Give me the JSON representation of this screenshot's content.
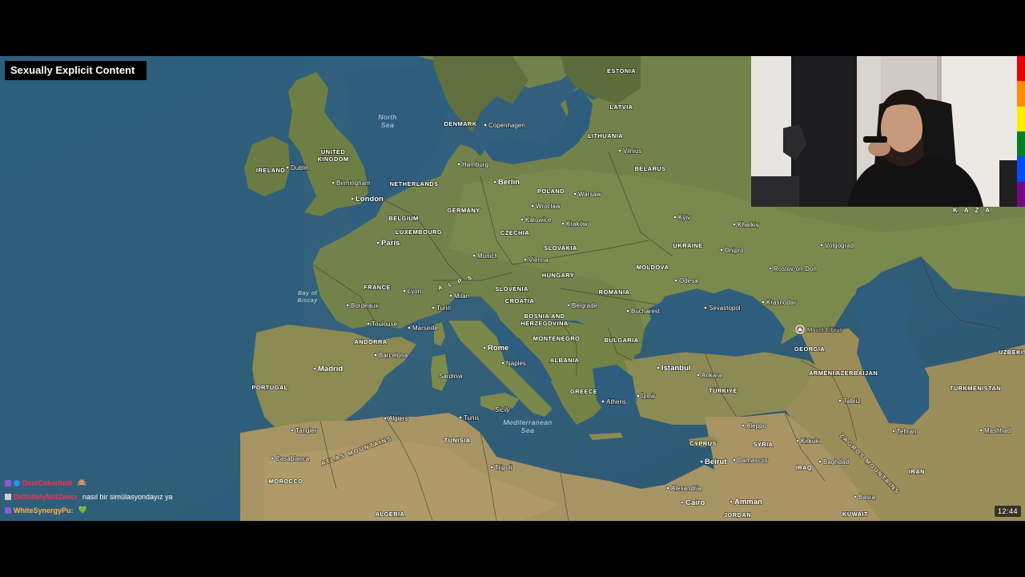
{
  "overlay": {
    "content_label": "Sexually Explicit Content",
    "clock": "12:44",
    "pride_colors": [
      "#e40303",
      "#ff8c00",
      "#ffed00",
      "#008026",
      "#004dff",
      "#750787"
    ]
  },
  "map": {
    "seas": {
      "north_sea_1": "North",
      "north_sea_2": "Sea",
      "biscay_1": "Bay of",
      "biscay_2": "Biscay",
      "med_1": "Mediterranean",
      "med_2": "Sea"
    },
    "countries": {
      "estonia": "ESTONIA",
      "latvia": "LATVIA",
      "lithuania": "LITHUANIA",
      "belarus": "BELARUS",
      "denmark": "DENMARK",
      "uk_1": "UNITED",
      "uk_2": "KINGDOM",
      "ireland": "IRELAND",
      "netherlands": "NETHERLANDS",
      "germany": "GERMANY",
      "poland": "POLAND",
      "belgium": "BELGIUM",
      "luxembourg": "LUXEMBOURG",
      "czechia": "CZECHIA",
      "slovakia": "SLOVAKIA",
      "ukraine": "UKRAINE",
      "moldova": "MOLDOVA",
      "hungary": "HUNGARY",
      "romania": "ROMANIA",
      "france": "FRANCE",
      "slovenia": "SLOVENIA",
      "croatia": "CROATIA",
      "bosnia_1": "BOSNIA AND",
      "bosnia_2": "HERZEGOVINA",
      "montenegro": "MONTENEGRO",
      "bulgaria": "BULGARIA",
      "albania": "ALBANIA",
      "greece": "GREECE",
      "andorra": "ANDORRA",
      "portugal": "PORTUGAL",
      "tunisia": "TUNISIA",
      "morocco": "MOROCCO",
      "algeria": "ALGERIA",
      "libya_cyprus": "CYPRUS",
      "syria": "SYRIA",
      "iraq": "IRAQ",
      "jordan": "JORDAN",
      "kuwait": "KUWAIT",
      "iran": "IRAN",
      "georgia": "GEORGIA",
      "armenia": "ARMENIA",
      "azerbaijan": "AZERBAIJAN",
      "turkiye": "TÜRKIYE",
      "turkmenistan": "TURKMENISTAN",
      "uzbekistan": "UZBEKIS",
      "kazakhstan": "K A Z A"
    },
    "ranges": {
      "alps": "A L P S",
      "atlas": "ATLAS MOUNTAINS",
      "zagros": "ZAGROS MOUNTAINS",
      "elbrus": "Mount Elbrus"
    },
    "cities": {
      "copenhagen": "Copenhagen",
      "vilnius": "Vilnius",
      "dublin": "Dublin",
      "birmingham": "Birmingham",
      "london": "London",
      "hamburg": "Hamburg",
      "berlin": "Berlin",
      "warsaw": "Warsaw",
      "wroclaw": "Wrocław",
      "katowice": "Katowice",
      "krakow": "Kraków",
      "kyiv": "Kyiv",
      "kharkiv": "Kharkiv",
      "volgograd": "Volgograd",
      "paris": "Paris",
      "munich": "Munich",
      "vienna": "Vienna",
      "dnipro": "Dnipro",
      "rostov": "Rostov-on-Don",
      "odesa": "Odesa",
      "lyon": "Lyon",
      "milan": "Milan",
      "turin": "Turin",
      "bordeaux": "Bordeaux",
      "belgrade": "Belgrade",
      "bucharest": "Bucharest",
      "sevastopol": "Sevastopol",
      "krasnodar": "Krasnodar",
      "toulouse": "Toulouse",
      "marseille": "Marseille",
      "barcelona": "Barcelona",
      "rome": "Rome",
      "madrid": "Madrid",
      "naples": "Naples",
      "istanbul": "Istanbul",
      "ankara": "Ankara",
      "sardinia": "Sardinia",
      "izmir": "İzmir",
      "athens": "Athens",
      "tabriz": "Tabriz",
      "sicily": "Sicily",
      "tangier": "Tangier",
      "algiers": "Algiers",
      "tunis": "Tunis",
      "aleppo": "Aleppo",
      "tehran": "Tehran",
      "mashhad": "Mashhad",
      "kirkuk": "Kirkuk",
      "casablanca": "Casablanca",
      "tripoli": "Tripoli",
      "beirut": "Beirut",
      "damascus": "Damascus",
      "baghdad": "Baghdad",
      "alexandria": "Alexandria",
      "amman": "Amman",
      "basra": "Basra",
      "cairo": "Cairo"
    }
  },
  "chat": [
    {
      "user": "DeniCekerliedi",
      "color": "#ff2f4f",
      "message": "",
      "emote": "🙈"
    },
    {
      "user": "DefinitelyNotZencr",
      "color": "#ff2f4f",
      "message": "nasıl bir simülasyondayız ya",
      "emote": ""
    },
    {
      "user": "WhiteSynergyPu:",
      "color": "#ffb347",
      "message": "",
      "emote": "💚"
    }
  ]
}
